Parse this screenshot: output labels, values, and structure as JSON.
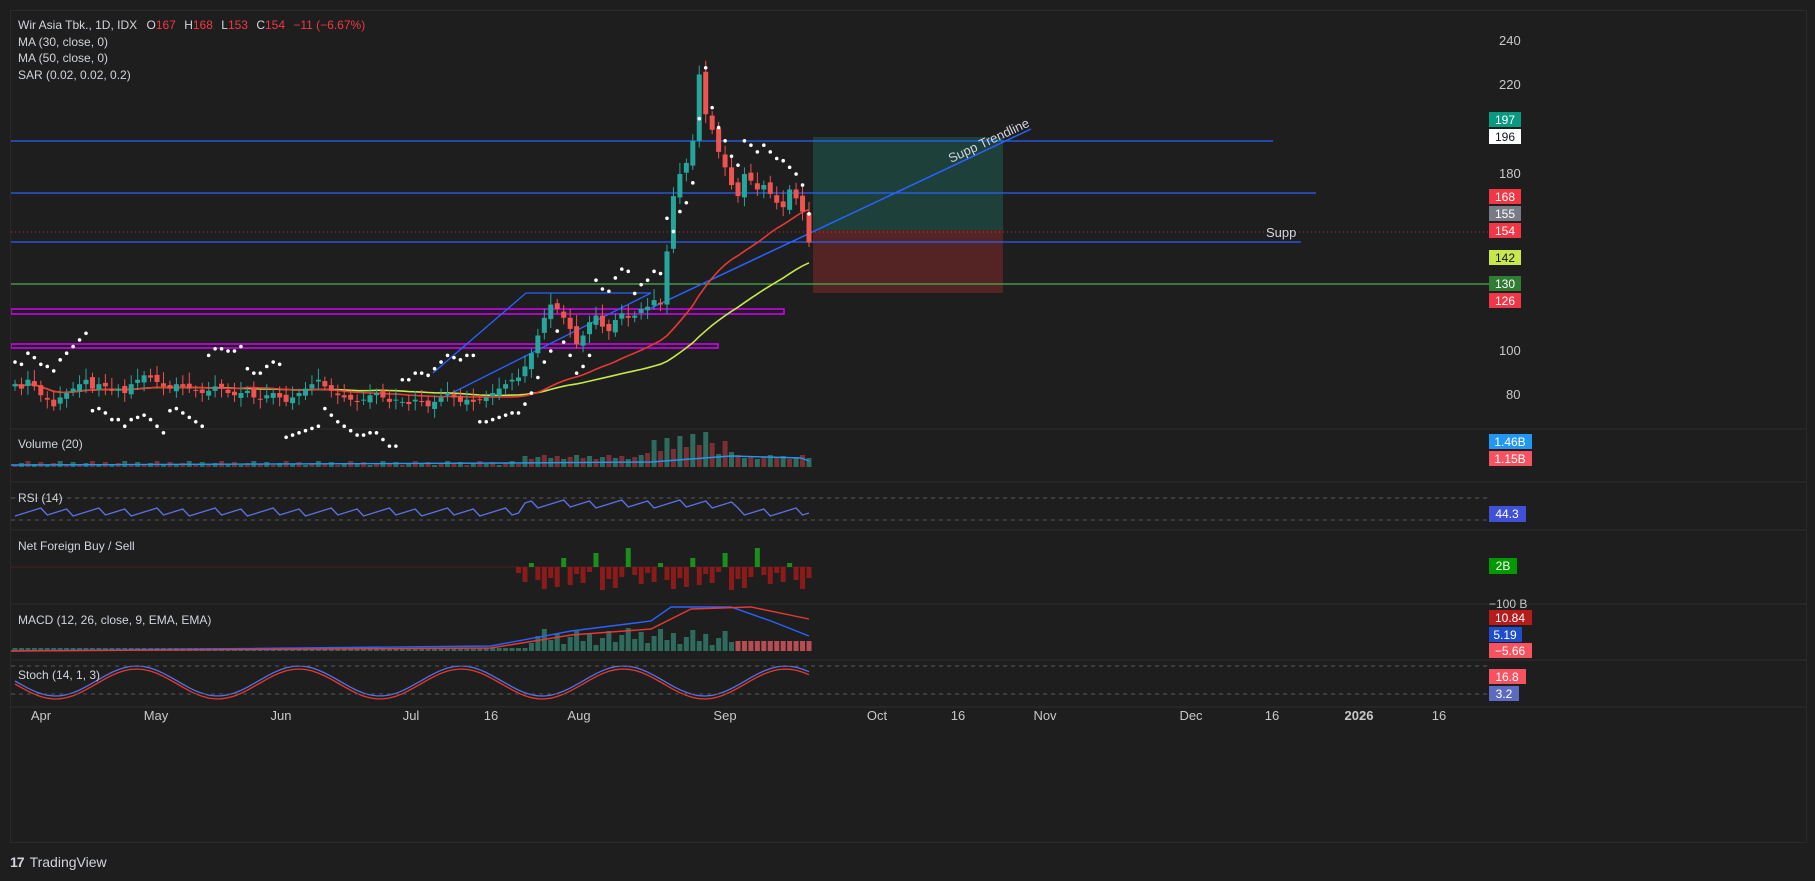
{
  "header": {
    "symbol": "Wir Asia Tbk., 1D, IDX",
    "o_label": "O",
    "o_value": "167",
    "h_label": "H",
    "h_value": "168",
    "l_label": "L",
    "l_value": "153",
    "c_label": "C",
    "c_value": "154",
    "change": "−11 (−6.67%)"
  },
  "indicators": {
    "ma30": "MA (30, close, 0)",
    "ma50": "MA (50, close, 0)",
    "sar": "SAR (0.02, 0.02, 0.2)",
    "volume": "Volume (20)",
    "rsi": "RSI (14)",
    "netforeign": "Net Foreign Buy / Sell",
    "macd": "MACD (12, 26, close, 9, EMA, EMA)",
    "stoch": "Stoch (14, 1, 3)"
  },
  "annotations": {
    "trendline": "Supp Trendline",
    "supp": "Supp"
  },
  "colors": {
    "up": "#26a69a",
    "down": "#ef5350",
    "ma30": "#e53935",
    "ma50": "#c6e84d",
    "sar": "#ffffff",
    "hline": "#2962ff",
    "green_line": "#4caf50",
    "zone": "#9c27b0"
  },
  "price_axis": {
    "ticks": [
      "240",
      "220",
      "180",
      "100",
      "80"
    ],
    "tags": [
      {
        "text": "197",
        "bg": "#089981",
        "fg": "#ffffff",
        "value": 197
      },
      {
        "text": "196",
        "bg": "#ffffff",
        "fg": "#131722",
        "value": 196
      },
      {
        "text": "168",
        "bg": "#f23645",
        "fg": "#ffffff",
        "value": 168
      },
      {
        "text": "155",
        "bg": "#787b86",
        "fg": "#ffffff",
        "value": 155
      },
      {
        "text": "154",
        "bg": "#f23645",
        "fg": "#ffffff",
        "value": 154
      },
      {
        "text": "142",
        "bg": "#c6e84d",
        "fg": "#131722",
        "value": 142
      },
      {
        "text": "130",
        "bg": "#2e7d32",
        "fg": "#ffffff",
        "value": 130
      },
      {
        "text": "126",
        "bg": "#f23645",
        "fg": "#ffffff",
        "value": 126
      }
    ]
  },
  "indicator_tags": {
    "vol1": {
      "text": "1.46B",
      "bg": "#2196f3"
    },
    "vol2": {
      "text": "1.15B",
      "bg": "#f7525f"
    },
    "rsi": {
      "text": "44.3",
      "bg": "#3f51d9"
    },
    "nf": {
      "text": "2B",
      "bg": "#009900"
    },
    "nf_axis": "−100 B",
    "macd1": {
      "text": "10.84",
      "bg": "#b71c1c"
    },
    "macd2": {
      "text": "5.19",
      "bg": "#1e4fc9"
    },
    "macd3": {
      "text": "−5.66",
      "bg": "#f7525f"
    },
    "stoch1": {
      "text": "16.8",
      "bg": "#f7525f"
    },
    "stoch2": {
      "text": "3.2",
      "bg": "#5c6bc0"
    }
  },
  "time_axis": [
    "Apr",
    "May",
    "Jun",
    "Jul",
    "16",
    "Aug",
    "Sep",
    "Oct",
    "16",
    "Nov",
    "Dec",
    "16",
    "2026",
    "16"
  ],
  "footer": {
    "brand": "TradingView"
  },
  "chart_data": {
    "type": "candlestick",
    "title": "Wir Asia Tbk., 1D, IDX",
    "y_ticks": [
      80,
      100,
      180,
      220,
      240
    ],
    "x_ticks": [
      "Apr",
      "May",
      "Jun",
      "Jul",
      "16",
      "Aug",
      "Sep",
      "Oct",
      "16",
      "Nov",
      "Dec",
      "16",
      "2026",
      "16"
    ],
    "last": {
      "open": 167,
      "high": 168,
      "low": 153,
      "close": 154,
      "change": -11,
      "change_pct": -6.67
    },
    "horizontal_levels": [
      {
        "value": 196,
        "color": "#2962ff"
      },
      {
        "value": 172,
        "color": "#2962ff"
      },
      {
        "value": 150,
        "color": "#2962ff",
        "label": "Supp"
      },
      {
        "value": 130,
        "color": "#4caf50"
      }
    ],
    "zones": [
      {
        "from": 117,
        "to": 120
      },
      {
        "from": 101,
        "to": 103
      }
    ],
    "close_series": [
      90,
      88,
      92,
      89,
      85,
      83,
      80,
      84,
      86,
      88,
      90,
      92,
      88,
      90,
      89,
      87,
      88,
      86,
      90,
      92,
      94,
      93,
      91,
      89,
      88,
      90,
      89,
      88,
      87,
      86,
      87,
      89,
      88,
      86,
      85,
      86,
      87,
      84,
      83,
      85,
      86,
      84,
      82,
      84,
      86,
      88,
      90,
      92,
      89,
      87,
      85,
      84,
      83,
      82,
      83,
      85,
      86,
      84,
      82,
      83,
      82,
      81,
      83,
      82,
      80,
      82,
      84,
      86,
      84,
      82,
      83,
      82,
      83,
      84,
      86,
      88,
      90,
      92,
      93,
      98,
      104,
      112,
      120,
      126,
      124,
      120,
      115,
      108,
      112,
      118,
      121,
      116,
      114,
      119,
      122,
      120,
      121,
      124,
      125,
      128,
      126,
      150,
      175,
      185,
      190,
      200,
      230,
      212,
      205,
      195,
      188,
      180,
      175,
      185,
      182,
      178,
      180,
      176,
      172,
      170,
      178,
      174,
      168,
      154
    ]
  }
}
